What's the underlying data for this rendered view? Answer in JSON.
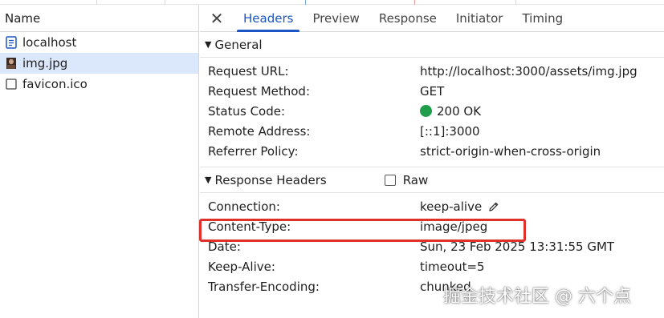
{
  "left_panel": {
    "header": "Name",
    "requests": [
      {
        "name": "localhost",
        "icon": "document-icon",
        "selected": false
      },
      {
        "name": "img.jpg",
        "icon": "image-thumbnail-icon",
        "selected": true
      },
      {
        "name": "favicon.ico",
        "icon": "file-icon",
        "selected": false
      }
    ]
  },
  "tabs": [
    "Headers",
    "Preview",
    "Response",
    "Initiator",
    "Timing"
  ],
  "active_tab": "Headers",
  "general": {
    "title": "General",
    "rows": [
      {
        "key": "Request URL:",
        "value": "http://localhost:3000/assets/img.jpg"
      },
      {
        "key": "Request Method:",
        "value": "GET"
      },
      {
        "key": "Status Code:",
        "value": "200 OK"
      },
      {
        "key": "Remote Address:",
        "value": "[::1]:3000"
      },
      {
        "key": "Referrer Policy:",
        "value": "strict-origin-when-cross-origin"
      }
    ]
  },
  "response_headers": {
    "title": "Response Headers",
    "raw_label": "Raw",
    "rows": [
      {
        "key": "Connection:",
        "value": "keep-alive"
      },
      {
        "key": "Content-Type:",
        "value": "image/jpeg"
      },
      {
        "key": "Date:",
        "value": "Sun, 23 Feb 2025 13:31:55 GMT"
      },
      {
        "key": "Keep-Alive:",
        "value": "timeout=5"
      },
      {
        "key": "Transfer-Encoding:",
        "value": "chunked"
      }
    ]
  },
  "watermark": "掘金技术社区 @ 六个点",
  "colors": {
    "accent": "#1a56c4",
    "selected_row": "#dbe7fb",
    "status_ok": "#1e9e4a",
    "highlight": "#e0302a"
  }
}
